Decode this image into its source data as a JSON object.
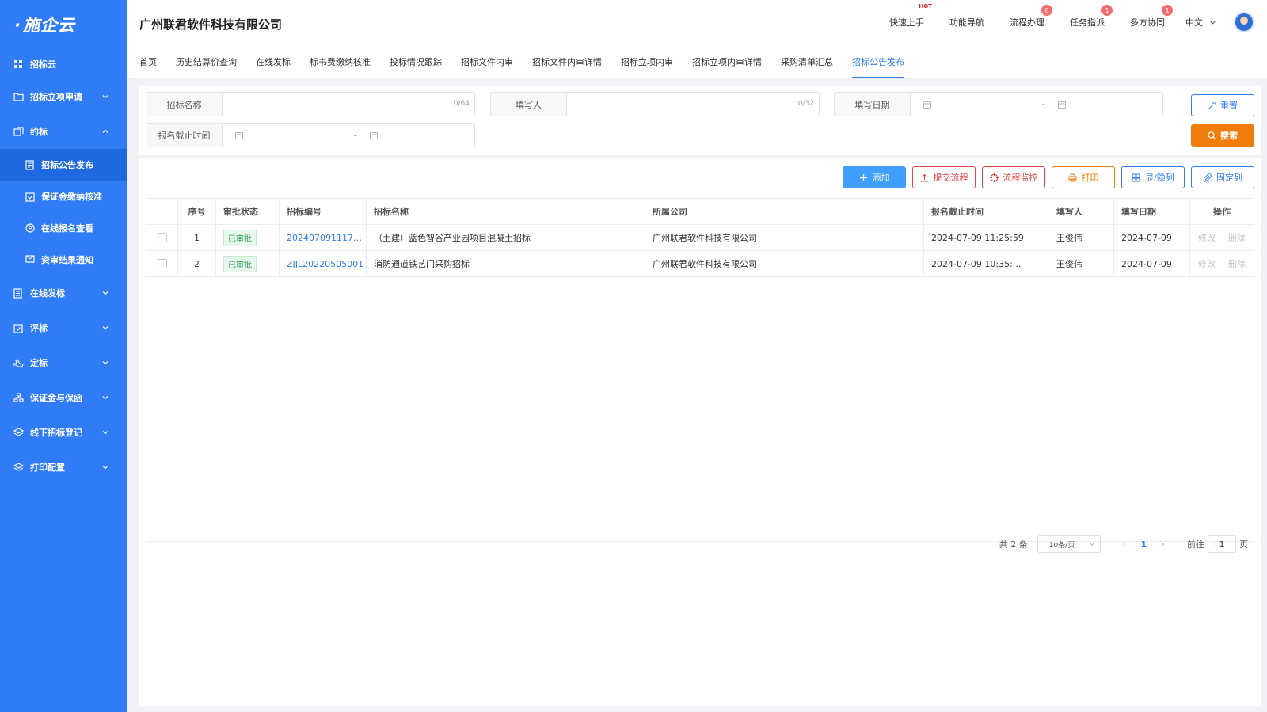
{
  "logo": "施企云",
  "sidebar": {
    "items": [
      {
        "label": "招标云",
        "icon": "grid-icon"
      },
      {
        "label": "招标立项申请",
        "icon": "folder-icon"
      },
      {
        "label": "约标",
        "icon": "stack-icon"
      },
      {
        "label": "在线发标",
        "icon": "document-icon"
      },
      {
        "label": "评标",
        "icon": "clipboard-icon"
      },
      {
        "label": "定标",
        "icon": "hand-icon"
      },
      {
        "label": "保证金与保函",
        "icon": "org-icon"
      },
      {
        "label": "线下招标登记",
        "icon": "layers-icon"
      },
      {
        "label": "打印配置",
        "icon": "layers-icon"
      }
    ],
    "sub_items": [
      {
        "label": "招标公告发布",
        "icon": "notice-icon"
      },
      {
        "label": "保证金缴纳核准",
        "icon": "check-clipboard-icon"
      },
      {
        "label": "在线报名查看",
        "icon": "user-circle-icon"
      },
      {
        "label": "资审结果通知",
        "icon": "mail-icon"
      }
    ]
  },
  "header": {
    "company": "广州联君软件科技有限公司",
    "links": [
      {
        "label": "快速上手",
        "hot": "HOT"
      },
      {
        "label": "功能导航"
      },
      {
        "label": "流程办理",
        "badge": "8"
      },
      {
        "label": "任务指派",
        "badge": "1"
      },
      {
        "label": "多方协同",
        "badge": "1"
      }
    ],
    "language": "中文"
  },
  "tabs": [
    "首页",
    "历史结算价查询",
    "在线发标",
    "标书费缴纳核准",
    "投标情况跟踪",
    "招标文件内审",
    "招标文件内审详情",
    "招标立项内审",
    "招标立项内审详情",
    "采购清单汇总",
    "招标公告发布"
  ],
  "active_tab": "招标公告发布",
  "search": {
    "bid_name_label": "招标名称",
    "bid_name_count": "0/64",
    "filler_label": "填写人",
    "filler_count": "0/32",
    "fill_date_label": "填写日期",
    "deadline_label": "报名截止时间",
    "range_sep": "-",
    "reset": "重置",
    "search": "搜索"
  },
  "toolbar": {
    "add": "添加",
    "submit_flow": "提交流程",
    "flow_monitor": "流程监控",
    "print": "打印",
    "show_hide": "显/隐列",
    "fix_cols": "固定列"
  },
  "table": {
    "headers": [
      "序号",
      "审批状态",
      "招标编号",
      "招标名称",
      "所属公司",
      "报名截止时间",
      "填写人",
      "填写日期",
      "操作"
    ],
    "rows": [
      {
        "idx": "1",
        "status": "已审批",
        "no": "2024070911170...",
        "name": "（土建）蓝色智谷产业园项目混凝土招标",
        "company": "广州联君软件科技有限公司",
        "deadline": "2024-07-09 11:25:59",
        "user": "王俊伟",
        "date": "2024-07-09",
        "edit": "修改",
        "del": "删除"
      },
      {
        "idx": "2",
        "status": "已审批",
        "no": "ZJJL20220505001",
        "name": "消防通道铁艺门采购招标",
        "company": "广州联君软件科技有限公司",
        "deadline": "2024-07-09 10:35:...",
        "user": "王俊伟",
        "date": "2024-07-09",
        "edit": "修改",
        "del": "删除"
      }
    ]
  },
  "pager": {
    "total": "共 2 条",
    "page_size": "10条/页",
    "current": "1",
    "goto_prefix": "前往",
    "goto_value": "1",
    "goto_suffix": "页"
  }
}
